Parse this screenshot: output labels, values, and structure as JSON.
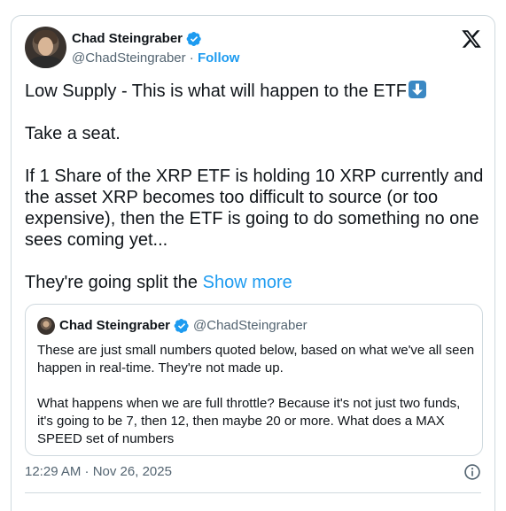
{
  "tweet": {
    "author": {
      "name": "Chad Steingraber",
      "handle": "@ChadSteingraber",
      "separator": " · ",
      "follow_label": "Follow"
    },
    "text": {
      "line1": "Low Supply - This is what will happen to the ETF",
      "line1_emoji": "down-arrow-emoji",
      "line2": "Take a seat.",
      "line3": "If 1 Share of the XRP ETF is holding 10 XRP currently and the asset XRP becomes too difficult to source (or too expensive), then the ETF is going to do something no one sees coming yet...",
      "line4": "They're going split the ",
      "show_more": "Show more"
    },
    "quote": {
      "name": "Chad Steingraber",
      "handle": "@ChadSteingraber",
      "paragraph1": "These are just small numbers quoted below, based on what we've all seen happen in real-time.  They're not made up.",
      "paragraph2": "What happens when we are full throttle?  Because it's not just two funds, it's going to be 7, then 12, then maybe 20 or more.  What does a MAX SPEED set of numbers"
    },
    "timestamp": "12:29 AM · Nov 26, 2025"
  },
  "icons": {
    "platform": "x-logo-icon",
    "verified": "verified-badge-icon",
    "info": "info-icon"
  },
  "colors": {
    "accent": "#1d9bf0",
    "text": "#0f1419",
    "secondary": "#536471",
    "border": "#cfd9de"
  }
}
